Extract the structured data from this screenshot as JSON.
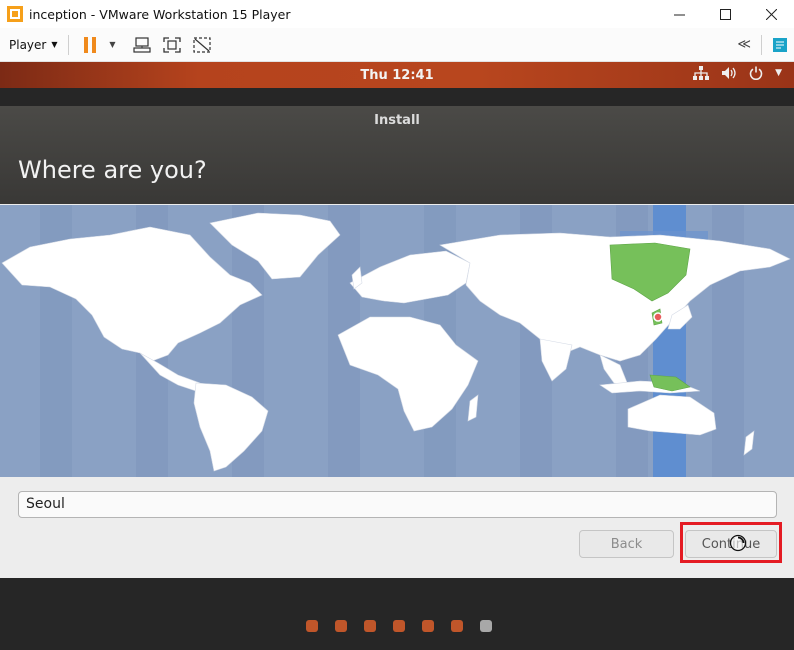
{
  "window": {
    "title": "inception - VMware Workstation 15 Player",
    "icon": "vmware-player-icon"
  },
  "toolbar": {
    "player_label": "Player",
    "icons": [
      "pause-icon",
      "send-ctrl-alt-del-icon",
      "full-screen-icon",
      "unity-icon",
      "collapse-toolbar-icon",
      "notes-icon"
    ]
  },
  "panel": {
    "clock": "Thu 12:41",
    "icons": [
      "network-icon",
      "volume-icon",
      "power-icon",
      "panel-menu-icon"
    ]
  },
  "installer": {
    "title": "Install",
    "heading": "Where are you?",
    "location_value": "Seoul",
    "back_label": "Back",
    "continue_label": "Continue"
  },
  "progress": {
    "total_steps": 7,
    "current_step": 7
  },
  "colors": {
    "ubuntu_orange": "#c0562a",
    "timezone_highlight": "#76c05a",
    "map_ocean": "#8aa1c4",
    "selection_box": "#e41b23"
  }
}
